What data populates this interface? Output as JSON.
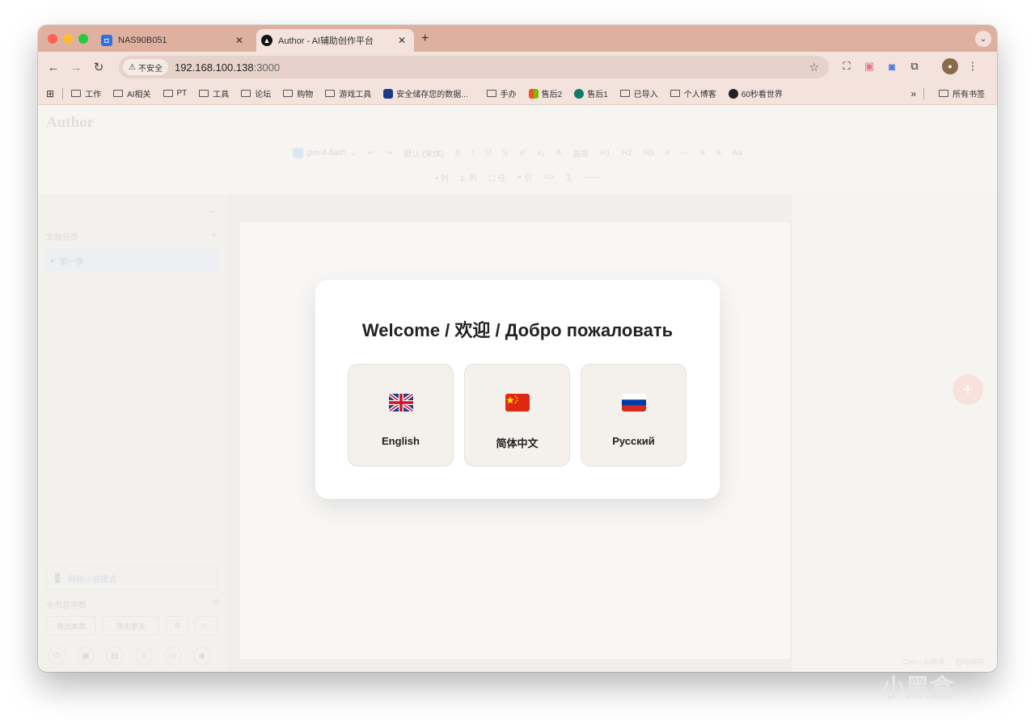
{
  "browser": {
    "tabs": [
      {
        "title": "NAS90B051",
        "favicon": "nas-icon",
        "color": "#2f6fe0",
        "active": false
      },
      {
        "title": "Author - AI辅助创作平台",
        "favicon": "author-icon",
        "color": "#111111",
        "active": true
      }
    ],
    "address": {
      "security_label": "不安全",
      "host": "192.168.100.138",
      "port": ":3000"
    },
    "bookmarks": [
      {
        "label": "工作",
        "type": "folder"
      },
      {
        "label": "AI相关",
        "type": "folder"
      },
      {
        "label": "PT",
        "type": "folder"
      },
      {
        "label": "工具",
        "type": "folder"
      },
      {
        "label": "论坛",
        "type": "folder"
      },
      {
        "label": "购物",
        "type": "folder"
      },
      {
        "label": "游戏工具",
        "type": "folder"
      },
      {
        "label": "安全储存您的数据...",
        "type": "site",
        "color": "#1d3a8a"
      },
      {
        "label": "手办",
        "type": "folder"
      },
      {
        "label": "售后2",
        "type": "site",
        "color": "#f25022"
      },
      {
        "label": "售后1",
        "type": "site",
        "color": "#0f7b6c"
      },
      {
        "label": "已导入",
        "type": "folder"
      },
      {
        "label": "个人博客",
        "type": "folder"
      },
      {
        "label": "60秒看世界",
        "type": "site",
        "color": "#222222"
      }
    ],
    "bookmarks_more": "»",
    "all_bookmarks": "所有书签"
  },
  "app": {
    "title": "Author",
    "model": "glm-4-flash",
    "font_select": "默认 (宋体)",
    "format_row1": [
      "B",
      "I",
      "U",
      "S",
      "x²",
      "x₂",
      "A",
      "高亮",
      "H1",
      "H2",
      "H3",
      "≡",
      "—",
      "≡",
      "≡",
      "Aa"
    ],
    "format_row2": [
      "• 列",
      "1. 列",
      "☐ 任",
      "❝ 引",
      "</>",
      "∑",
      "——"
    ],
    "sidebar": {
      "section_label": "文档分页",
      "chapter": "第一章",
      "novel_mode": "网络小说模式",
      "total_words_label": "全书总字数",
      "total_words_value": "0",
      "export_chapter": "导出本章",
      "export_all": "导出更多"
    },
    "status": {
      "ai_hint": "Ctrl+J AI助手",
      "autosave": "自动保存"
    }
  },
  "modal": {
    "title": "Welcome / 欢迎 / Добро пожаловать",
    "options": [
      {
        "label": "English",
        "flag": "uk-flag-icon"
      },
      {
        "label": "简体中文",
        "flag": "china-flag-icon"
      },
      {
        "label": "Русский",
        "flag": "russia-flag-icon"
      }
    ]
  },
  "watermark": "小黑盒"
}
